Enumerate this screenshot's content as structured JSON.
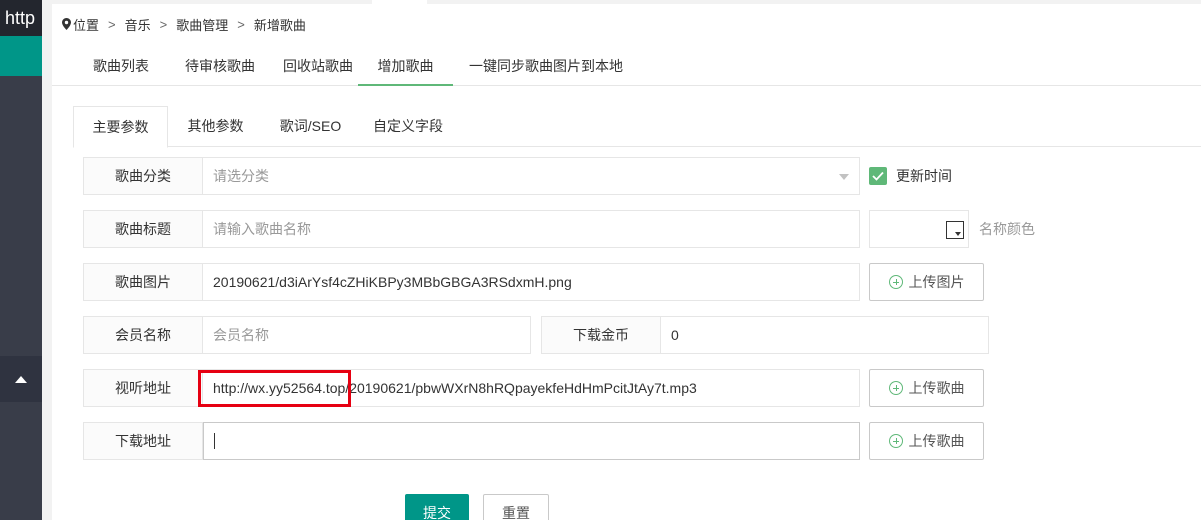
{
  "sidebar": {
    "brand": "http"
  },
  "breadcrumb": [
    "位置",
    "音乐",
    "歌曲管理",
    "新增歌曲"
  ],
  "top_tabs": [
    "歌曲列表",
    "待审核歌曲",
    "回收站歌曲",
    "增加歌曲",
    "一键同步歌曲图片到本地"
  ],
  "card_tabs": [
    "主要参数",
    "其他参数",
    "歌词/SEO",
    "自定义字段"
  ],
  "form": {
    "category": {
      "label": "歌曲分类",
      "placeholder": "请选分类"
    },
    "update_time_label": "更新时间",
    "title": {
      "label": "歌曲标题",
      "placeholder": "请输入歌曲名称"
    },
    "name_color_label": "名称颜色",
    "image": {
      "label": "歌曲图片",
      "value": "20190621/d3iArYsf4cZHiKBPy3MBbGBGA3RSdxmH.png",
      "upload_label": "上传图片"
    },
    "member": {
      "label": "会员名称",
      "placeholder": "会员名称"
    },
    "coins": {
      "label": "下载金币",
      "value": "0"
    },
    "listen_url": {
      "label": "视听地址",
      "value": "http://wx.yy52564.top/20190621/pbwWXrN8hRQpayekfeHdHmPcitJtAy7t.mp3",
      "upload_label": "上传歌曲"
    },
    "download_url": {
      "label": "下载地址",
      "value": "",
      "upload_label": "上传歌曲"
    }
  },
  "buttons": {
    "submit": "提交",
    "reset": "重置"
  },
  "colors": {
    "accent": "#009688",
    "tab_active": "#5fb878",
    "highlight": "#e60012"
  }
}
